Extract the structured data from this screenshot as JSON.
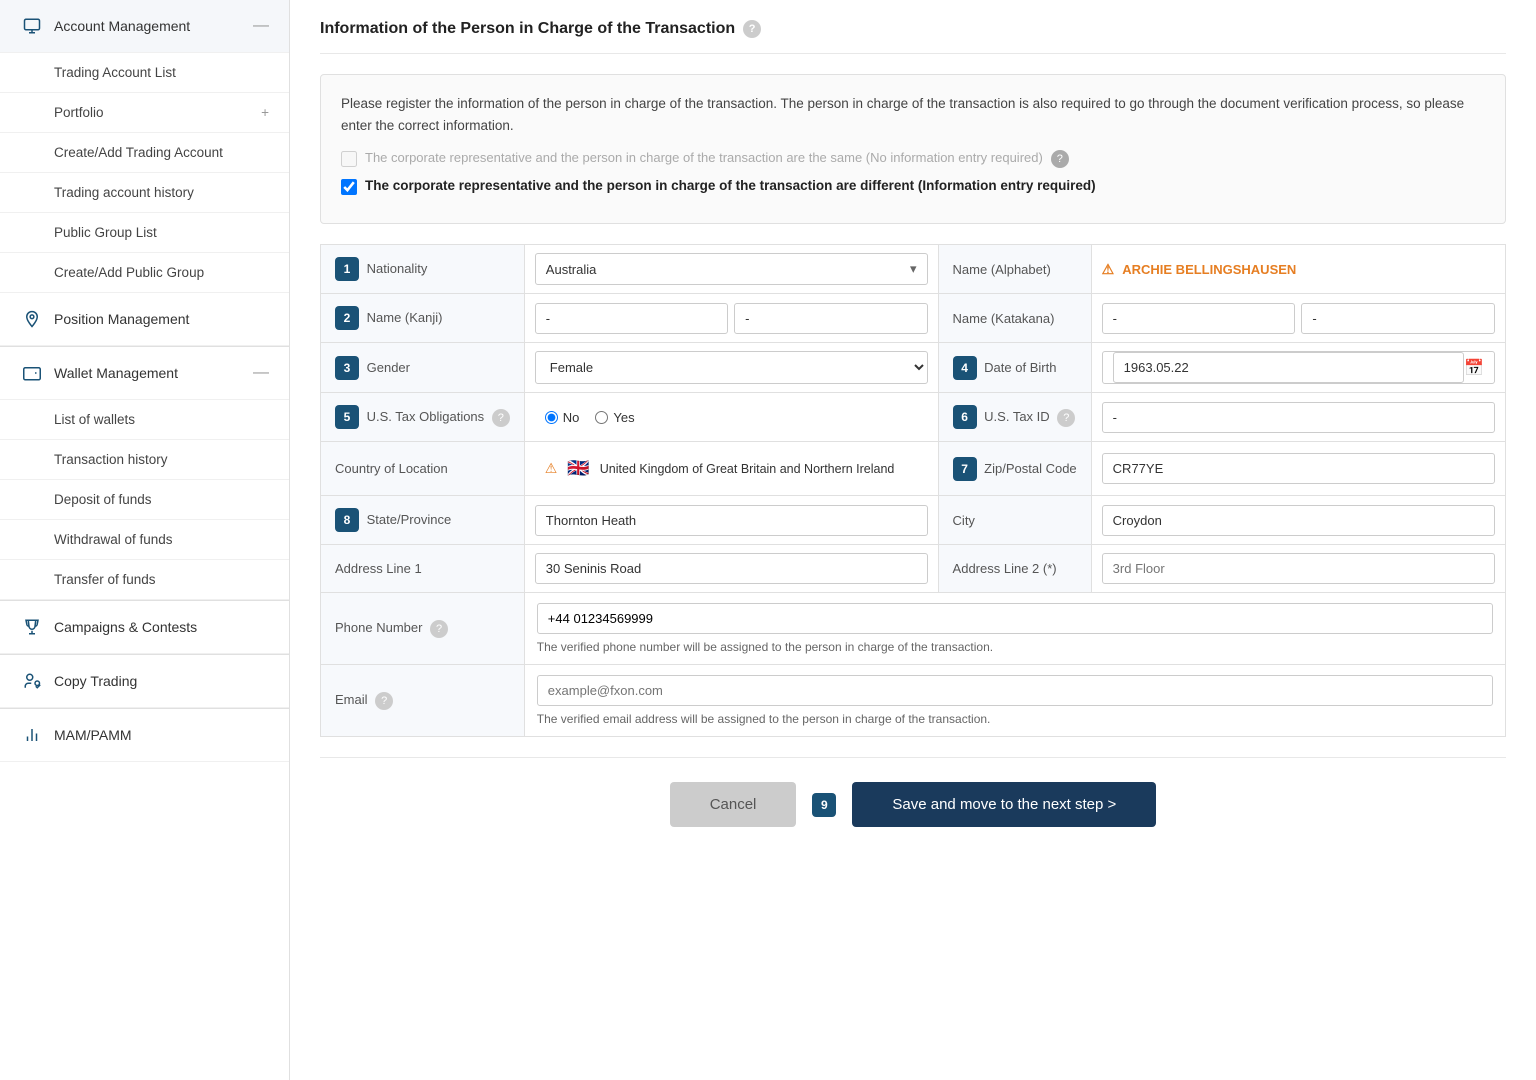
{
  "sidebar": {
    "items": [
      {
        "id": "account-management",
        "label": "Account Management",
        "icon": "monitor",
        "expandable": true,
        "expanded": true
      },
      {
        "id": "trading-account-list",
        "label": "Trading Account List",
        "sub": true
      },
      {
        "id": "portfolio",
        "label": "Portfolio",
        "sub": true,
        "expandable": true
      },
      {
        "id": "create-trading-account",
        "label": "Create/Add Trading Account",
        "sub": true
      },
      {
        "id": "trading-account-history",
        "label": "Trading account history",
        "sub": true
      },
      {
        "id": "public-group-list",
        "label": "Public Group List",
        "sub": true
      },
      {
        "id": "create-public-group",
        "label": "Create/Add Public Group",
        "sub": true
      },
      {
        "id": "position-management",
        "label": "Position Management",
        "icon": "pin"
      },
      {
        "id": "wallet-management",
        "label": "Wallet Management",
        "icon": "wallet",
        "expandable": true,
        "expanded": true
      },
      {
        "id": "list-of-wallets",
        "label": "List of wallets",
        "sub": true
      },
      {
        "id": "transaction-history",
        "label": "Transaction history",
        "sub": true
      },
      {
        "id": "deposit-of-funds",
        "label": "Deposit of funds",
        "sub": true
      },
      {
        "id": "withdrawal-of-funds",
        "label": "Withdrawal of funds",
        "sub": true
      },
      {
        "id": "transfer-of-funds",
        "label": "Transfer of funds",
        "sub": true
      },
      {
        "id": "campaigns-contests",
        "label": "Campaigns & Contests",
        "icon": "trophy"
      },
      {
        "id": "copy-trading",
        "label": "Copy Trading",
        "icon": "copy"
      },
      {
        "id": "mam-pamm",
        "label": "MAM/PAMM",
        "icon": "chart"
      }
    ]
  },
  "page": {
    "title": "Information of the Person in Charge of the Transaction",
    "info_text": "Please register the information of the person in charge of the transaction. The person in charge of the transaction is also required to go through the document verification process, so please enter the correct information.",
    "checkbox1_label": "The corporate representative and the person in charge of the transaction are the same (No information entry required)",
    "checkbox2_label": "The corporate representative and the person in charge of the transaction are different (Information entry required)"
  },
  "form": {
    "steps": [
      {
        "num": "1",
        "label": "Nationality"
      },
      {
        "num": "2",
        "label": "Name (Kanji)"
      },
      {
        "num": "3",
        "label": "Gender"
      },
      {
        "num": "4",
        "label": "Date of Birth"
      },
      {
        "num": "5",
        "label": "U.S. Tax Obligations"
      },
      {
        "num": "6",
        "label": "U.S. Tax ID"
      },
      {
        "num": "7",
        "label": "Zip/Postal Code"
      },
      {
        "num": "8",
        "label": "State/Province"
      }
    ],
    "nationality_value": "Australia",
    "name_alphabet_label": "Name (Alphabet)",
    "name_alphabet_value": "ARCHIE BELLINGSHAUSEN",
    "name_kanji_label": "Name (Kanji)",
    "name_kanji_val1": "-",
    "name_kanji_val2": "-",
    "name_katakana_label": "Name (Katakana)",
    "name_katakana_val1": "-",
    "name_katakana_val2": "-",
    "gender_label": "Gender",
    "gender_value": "Female",
    "dob_label": "Date of Birth",
    "dob_value": "1963.05.22",
    "us_tax_label": "U.S. Tax Obligations",
    "us_tax_no": "No",
    "us_tax_yes": "Yes",
    "us_tax_id_label": "U.S. Tax ID",
    "us_tax_id_value": "-",
    "country_label": "Country of Location",
    "country_value": "United Kingdom of Great Britain and Northern Ireland",
    "zip_label": "Zip/Postal Code",
    "zip_value": "CR77YE",
    "state_label": "State/Province",
    "state_value": "Thornton Heath",
    "city_label": "City",
    "city_value": "Croydon",
    "address1_label": "Address Line 1",
    "address1_value": "30 Seninis Road",
    "address2_label": "Address Line 2 (*)",
    "address2_placeholder": "3rd Floor",
    "phone_label": "Phone Number",
    "phone_value": "+44 01234569999",
    "phone_note": "The verified phone number will be assigned to the person in charge of the transaction.",
    "email_label": "Email",
    "email_placeholder": "example@fxon.com",
    "email_note": "The verified email address will be assigned to the person in charge of the transaction."
  },
  "buttons": {
    "cancel": "Cancel",
    "save": "Save and move to the next step >",
    "step9": "9"
  }
}
